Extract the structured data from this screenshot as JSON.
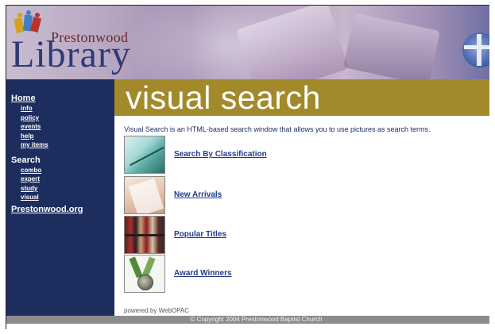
{
  "header": {
    "logo_prestonwood": "Prestonwood",
    "logo_library": "Library"
  },
  "sidebar": {
    "home": "Home",
    "home_items": [
      "info",
      "policy",
      "events",
      "help",
      "my items"
    ],
    "search": "Search",
    "search_items": [
      "combo",
      "expert",
      "study",
      "visual"
    ],
    "site": "Prestonwood.org"
  },
  "main": {
    "title": "visual search",
    "description": "Visual Search is an HTML-based search window that allows you to use pictures as search terms.",
    "items": [
      {
        "label": "Search By Classification",
        "icon": "classification-thumbnail"
      },
      {
        "label": "New Arrivals",
        "icon": "new-arrivals-thumbnail"
      },
      {
        "label": "Popular Titles",
        "icon": "popular-titles-thumbnail"
      },
      {
        "label": "Award Winners",
        "icon": "award-winners-thumbnail"
      }
    ],
    "powered_by": "powered by WebOPAC"
  },
  "footer": {
    "copyright": "© Copyright 2004 Prestonwood Baptist Church"
  },
  "colors": {
    "sidebar_bg": "#1d2d5e",
    "title_bar_bg": "#a28a2b",
    "link": "#1f3a8a",
    "footer_bg": "#8c8c8c"
  }
}
